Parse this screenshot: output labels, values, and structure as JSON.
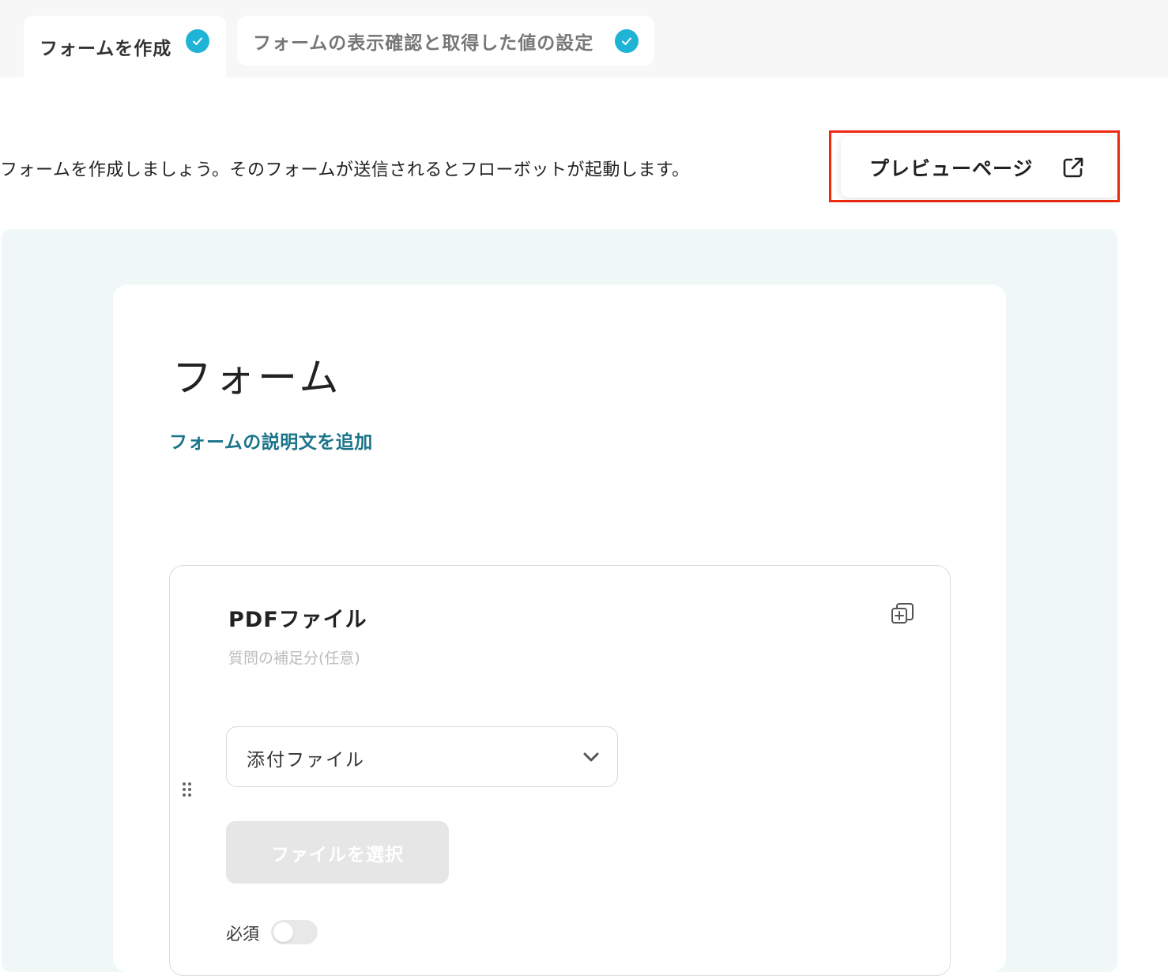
{
  "tabs": [
    {
      "label": "フォームを作成",
      "completed": true
    },
    {
      "label": "フォームの表示確認と取得した値の設定",
      "completed": true
    }
  ],
  "intro_text": "フォームを作成しましょう。そのフォームが送信されるとフローボットが起動します。",
  "preview_button": {
    "label": "プレビューページ",
    "icon": "external-link-icon",
    "highlight_color": "#ee2a10"
  },
  "form": {
    "title": "フォーム",
    "add_description_link": "フォームの説明文を追加"
  },
  "question": {
    "title": "PDFファイル",
    "description_placeholder": "質問の補足分(任意)",
    "type_select_value": "添付ファイル",
    "file_button_label": "ファイルを選択",
    "required_label": "必須",
    "required_enabled": false
  },
  "colors": {
    "accent_check": "#1fb4d6",
    "link": "#1a7489",
    "canvas_bg": "#f0f8f7"
  }
}
